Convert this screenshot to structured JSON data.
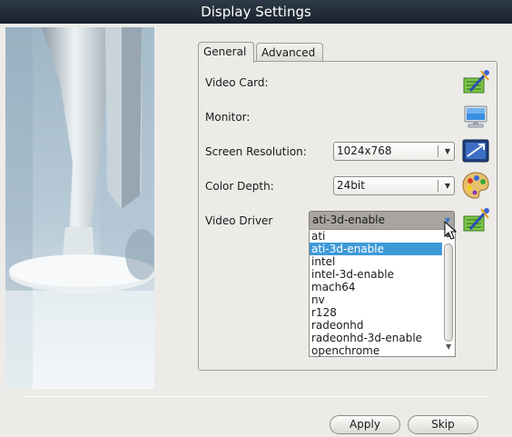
{
  "window": {
    "title": "Display Settings"
  },
  "tabs": [
    {
      "label": "General",
      "active": true
    },
    {
      "label": "Advanced",
      "active": false
    }
  ],
  "rows": {
    "video_card": {
      "label": "Video Card:",
      "icon": "video-card-wrench-icon"
    },
    "monitor": {
      "label": "Monitor:",
      "icon": "monitor-icon"
    },
    "resolution": {
      "label": "Screen Resolution:",
      "value": "1024x768",
      "icon": "resolution-icon"
    },
    "color_depth": {
      "label": "Color Depth:",
      "value": "24bit",
      "icon": "palette-icon"
    },
    "video_driver": {
      "label": "Video Driver",
      "value": "ati-3d-enable",
      "icon": "driver-wrench-icon"
    }
  },
  "driver_dropdown": {
    "options": [
      "ati",
      "ati-3d-enable",
      "intel",
      "intel-3d-enable",
      "mach64",
      "nv",
      "r128",
      "radeonhd",
      "radeonhd-3d-enable",
      "openchrome"
    ],
    "selected": "ati-3d-enable"
  },
  "buttons": {
    "apply": "Apply",
    "skip": "Skip"
  },
  "colors": {
    "titlebar": "#1f2935",
    "selection": "#3d9ad9",
    "background": "#ecebe8"
  }
}
